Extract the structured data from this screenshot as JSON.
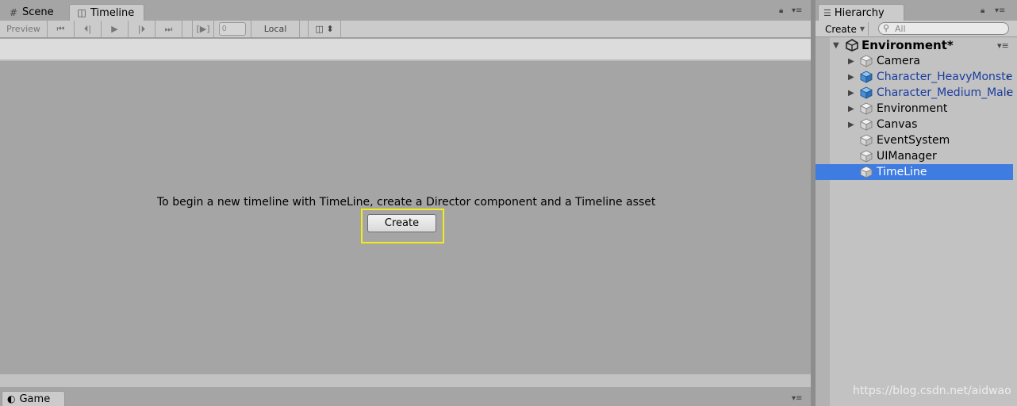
{
  "tabs": {
    "scene": "Scene",
    "timeline": "Timeline",
    "game": "Game",
    "hierarchy": "Hierarchy"
  },
  "toolbar": {
    "preview": "Preview",
    "frame_value": "0",
    "space": "Local"
  },
  "timeline": {
    "message": "To begin a new timeline with TimeLine, create a Director component and a Timeline asset",
    "create_button": "Create"
  },
  "hierarchy": {
    "create_label": "Create",
    "search_placeholder": "All",
    "scene_name": "Environment*",
    "items": [
      {
        "label": "Camera",
        "expandable": true,
        "prefab": false
      },
      {
        "label": "Character_HeavyMonster",
        "expandable": true,
        "prefab": true
      },
      {
        "label": "Character_Medium_Male_",
        "expandable": true,
        "prefab": true
      },
      {
        "label": "Environment",
        "expandable": true,
        "prefab": false
      },
      {
        "label": "Canvas",
        "expandable": true,
        "prefab": false
      },
      {
        "label": "EventSystem",
        "expandable": false,
        "prefab": false
      },
      {
        "label": "UIManager",
        "expandable": false,
        "prefab": false
      },
      {
        "label": "TimeLine",
        "expandable": false,
        "prefab": false,
        "selected": true
      }
    ]
  },
  "watermark": "https://blog.csdn.net/aidwao",
  "colors": {
    "selection": "#3e7ce2",
    "highlight_box": "#f3ec19",
    "prefab_text": "#1a3ca0"
  }
}
